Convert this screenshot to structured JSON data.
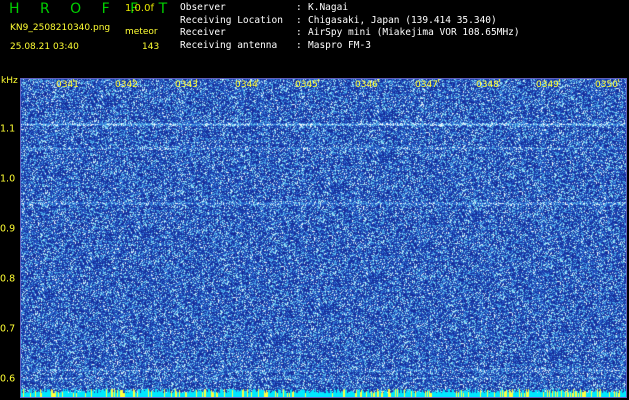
{
  "header": {
    "app_title": "H R O F F T",
    "version": "1.0.0f",
    "filename": "KN9_2508210340.png",
    "mode": "meteor",
    "timestamp": "25.08.21 03:40",
    "count": "143"
  },
  "info": [
    {
      "key": "Observer",
      "value": "K.Nagai"
    },
    {
      "key": "Receiving Location",
      "value": "Chigasaki, Japan (139.414 35.340)"
    },
    {
      "key": "Receiver",
      "value": "AirSpy mini (Miakejima VOR 108.65MHz)"
    },
    {
      "key": "Receiving antenna",
      "value": "Maspro FM-3"
    }
  ],
  "spectrogram": {
    "unit": "kHz",
    "y_ticks": [
      "1.1",
      "1.0",
      "0.9",
      "0.8",
      "0.7",
      "0.6"
    ],
    "x_ticks": [
      "0341",
      "0342",
      "0343",
      "0344",
      "0345",
      "0346",
      "0347",
      "0348",
      "0349",
      "0350"
    ],
    "colors": {
      "background": "#1a2fa8",
      "noise_low": "#2f5fd6",
      "noise_high": "#ffffff",
      "signal": "#80ffd0",
      "baseline": "#00e0ff"
    }
  }
}
